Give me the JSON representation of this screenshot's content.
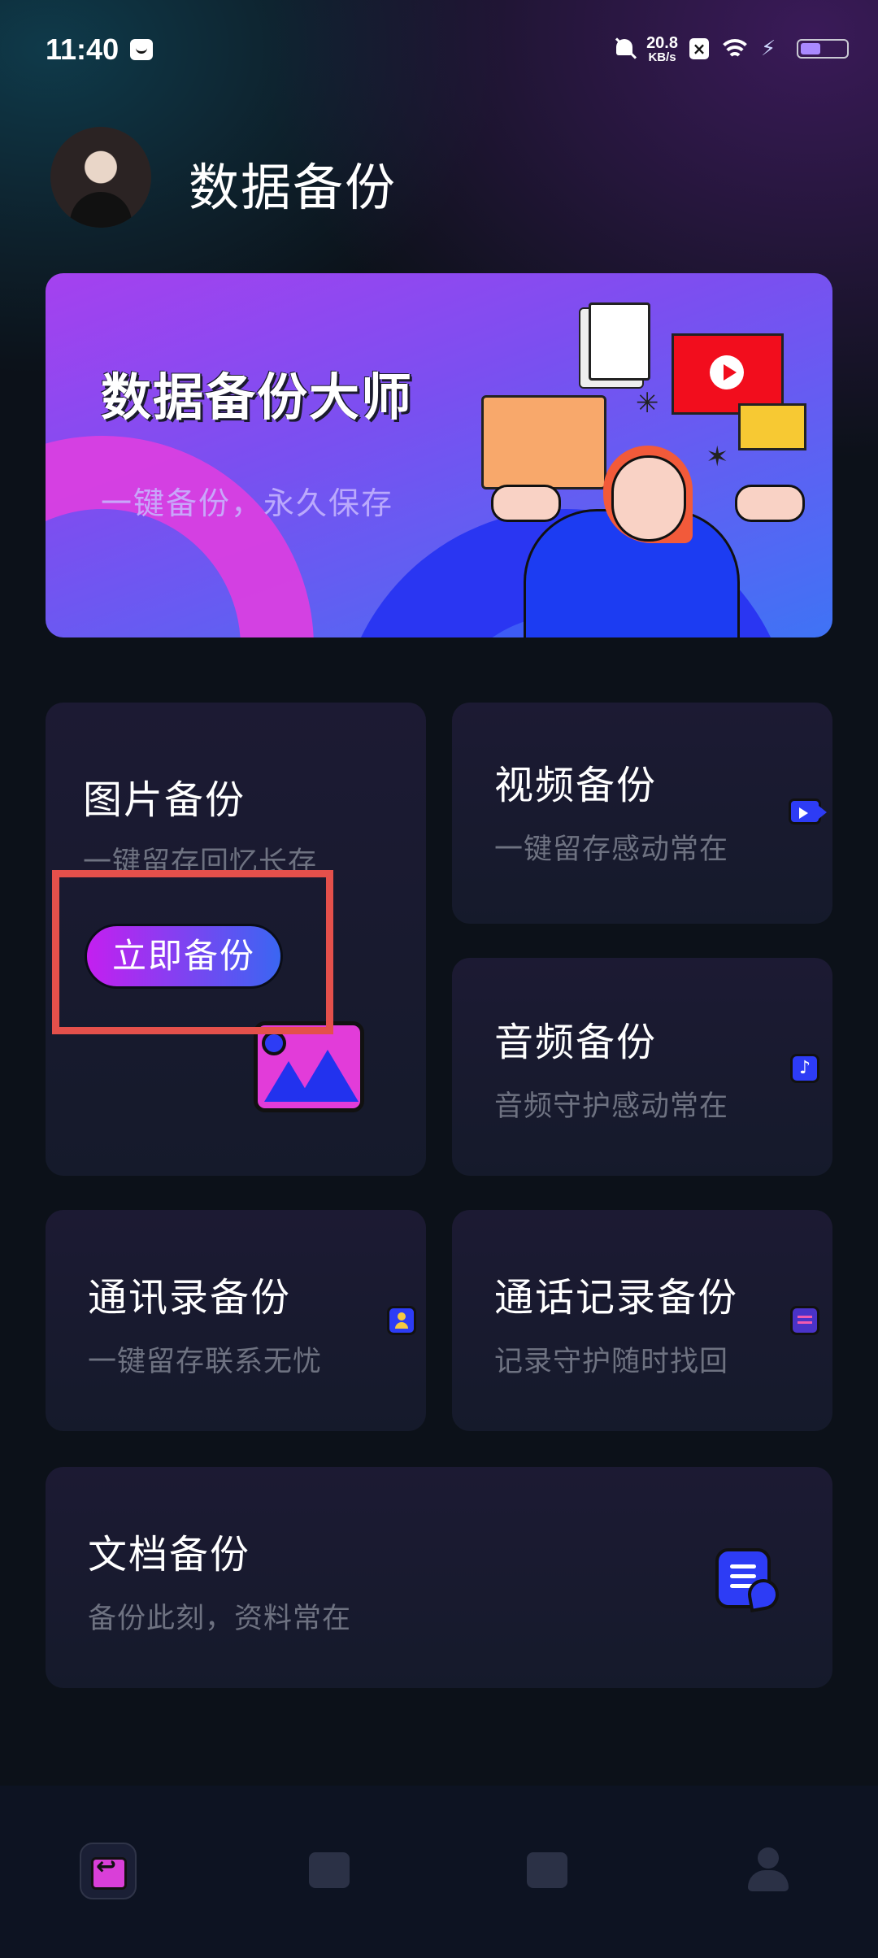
{
  "status_bar": {
    "time": "11:40",
    "net_speed_value": "20.8",
    "net_speed_unit": "KB/s",
    "icons": [
      "message-icon",
      "bell-muted-icon",
      "close-box-icon",
      "wifi-icon",
      "flash-icon",
      "battery-icon"
    ],
    "battery_level": 0.45
  },
  "header": {
    "title": "数据备份"
  },
  "banner": {
    "title": "数据备份大师",
    "subtitle": "一键备份，永久保存"
  },
  "cards": {
    "photo": {
      "title": "图片备份",
      "subtitle": "一键留存回忆长存",
      "button": "立即备份",
      "icon": "image-icon"
    },
    "video": {
      "title": "视频备份",
      "subtitle": "一键留存感动常在",
      "icon": "video-camera-icon"
    },
    "audio": {
      "title": "音频备份",
      "subtitle": "音频守护感动常在",
      "icon": "music-note-icon"
    },
    "contacts": {
      "title": "通讯录备份",
      "subtitle": "一键留存联系无忧",
      "icon": "contact-icon"
    },
    "calls": {
      "title": "通话记录备份",
      "subtitle": "记录守护随时找回",
      "icon": "clipboard-icon"
    },
    "docs": {
      "title": "文档备份",
      "subtitle": "备份此刻，资料常在",
      "icon": "document-edit-icon"
    }
  },
  "bottom_nav": {
    "items": [
      "backup-nav-icon",
      "book-nav-icon",
      "camera-nav-icon",
      "profile-nav-icon"
    ],
    "active": "backup-nav-icon"
  },
  "colors": {
    "background": "#0c1119",
    "card": "#1a1a30",
    "accent_magenta": "#c41ff0",
    "accent_blue": "#3a66f2",
    "highlight": "#e4504b"
  }
}
